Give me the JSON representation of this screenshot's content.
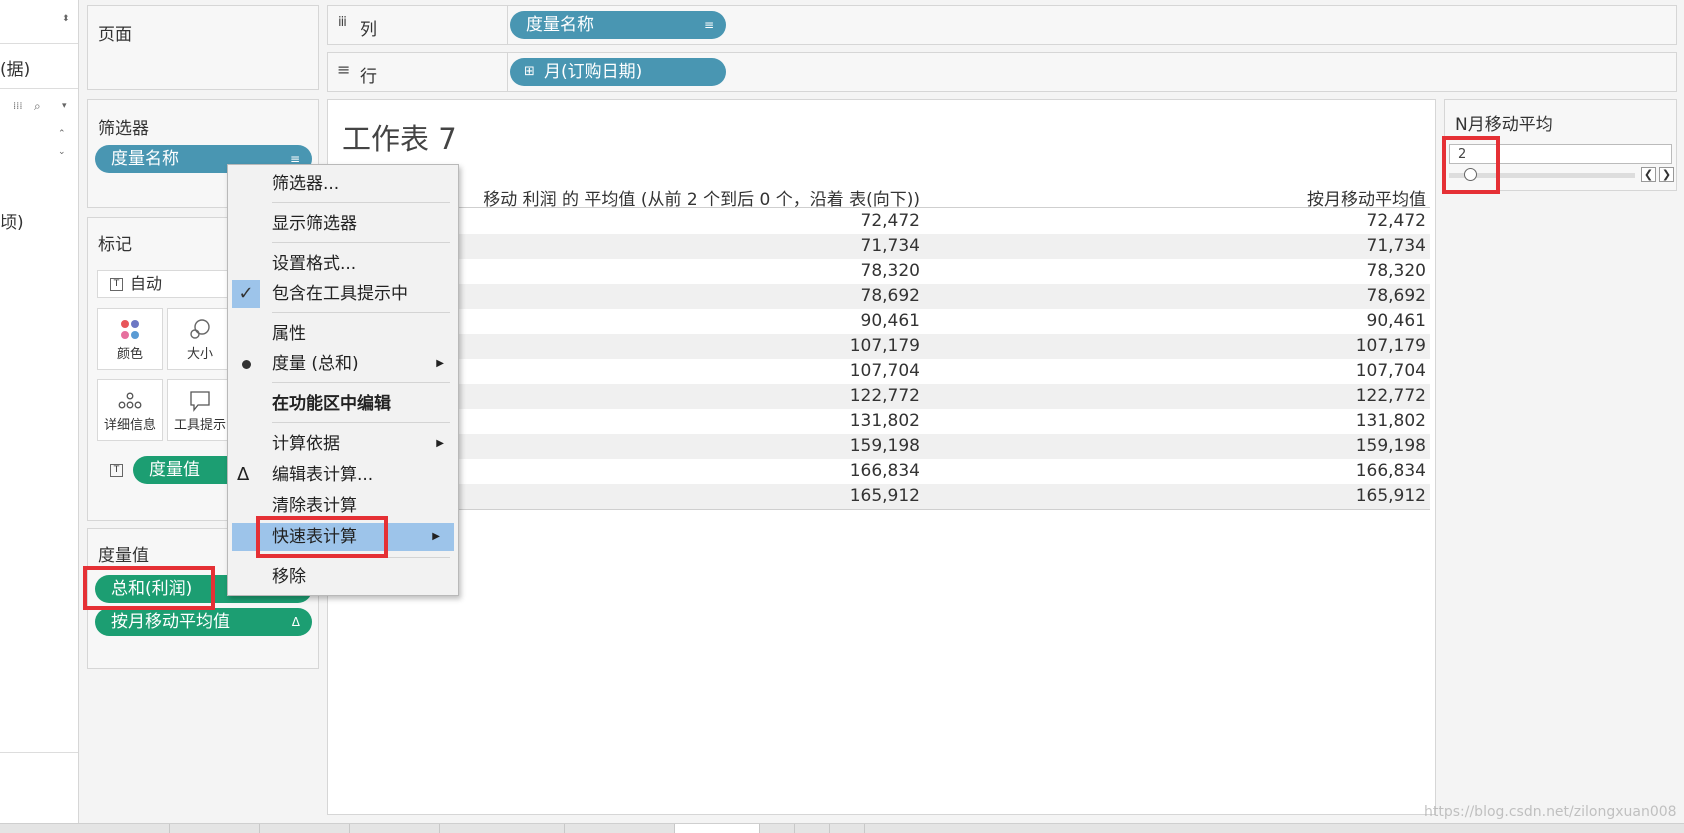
{
  "left_strip": {
    "fragment1": "(据)",
    "fragment2": "顷)"
  },
  "pages": {
    "title": "页面"
  },
  "columns_shelf": {
    "icon": "columns-icon",
    "label": "列",
    "pill": "度量名称"
  },
  "rows_shelf": {
    "icon": "rows-icon",
    "label": "行",
    "pill": "月(订购日期)"
  },
  "filters": {
    "title": "筛选器",
    "pill": "度量名称"
  },
  "marks": {
    "title": "标记",
    "dropdown": "自动",
    "buttons": [
      "颜色",
      "大小",
      "详细信息",
      "工具提示"
    ],
    "pill": "度量值"
  },
  "measure_values": {
    "title": "度量值",
    "pills": [
      "总和(利润)",
      "按月移动平均值"
    ]
  },
  "sheet": {
    "title": "工作表 7",
    "headers": [
      "移动 利润 的 平均值 (从前 2 个到后 0 个，沿着 表(向下))",
      "按月移动平均值"
    ],
    "rows": [
      [
        "72,472",
        "72,472"
      ],
      [
        "71,734",
        "71,734"
      ],
      [
        "78,320",
        "78,320"
      ],
      [
        "78,692",
        "78,692"
      ],
      [
        "90,461",
        "90,461"
      ],
      [
        "107,179",
        "107,179"
      ],
      [
        "107,704",
        "107,704"
      ],
      [
        "122,772",
        "122,772"
      ],
      [
        "131,802",
        "131,802"
      ],
      [
        "159,198",
        "159,198"
      ],
      [
        "166,834",
        "166,834"
      ],
      [
        "165,912",
        "165,912"
      ]
    ]
  },
  "parameter": {
    "title": "N月移动平均",
    "value": "2"
  },
  "context_menu": {
    "items": [
      "筛选器...",
      "显示筛选器",
      "设置格式...",
      "包含在工具提示中",
      "属性",
      "度量 (总和)",
      "在功能区中编辑",
      "计算依据",
      "编辑表计算...",
      "清除表计算",
      "快速表计算",
      "移除"
    ]
  },
  "watermark": "https://blog.csdn.net/zilongxuan008",
  "colors": {
    "pill_blue": "#4996b2",
    "pill_green": "#1c9e72",
    "highlight": "#9dc4ea",
    "annotation": "#e53035"
  }
}
